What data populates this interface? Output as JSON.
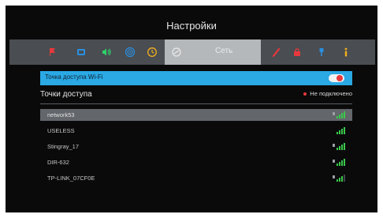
{
  "title": "Настройки",
  "tabs": [
    {
      "icon": "flag-icon",
      "color": "#e8383c"
    },
    {
      "icon": "display-icon",
      "color": "#2a8fe0"
    },
    {
      "icon": "sound-icon",
      "color": "#2fd16b"
    },
    {
      "icon": "broadcast-icon",
      "color": "#2a8fe0"
    },
    {
      "icon": "clock-icon",
      "color": "#f2b01e"
    },
    {
      "icon": "network-icon",
      "label": "Сеть",
      "selected": true
    },
    {
      "icon": "brush-icon",
      "color": "#e8383c"
    },
    {
      "icon": "lock-icon",
      "color": "#e8383c"
    },
    {
      "icon": "usb-icon",
      "color": "#2a8fe0"
    },
    {
      "icon": "info-icon",
      "color": "#f2b01e"
    }
  ],
  "hotspot": {
    "label": "Точка доступа Wi-Fi",
    "enabled": false
  },
  "access_points": {
    "title": "Точки доступа",
    "status": "Не подключено",
    "networks": [
      {
        "name": "network53",
        "secured": true,
        "signal": 4,
        "selected": true
      },
      {
        "name": "USELESS",
        "secured": false,
        "signal": 4
      },
      {
        "name": "Stingray_17",
        "secured": true,
        "signal": 4
      },
      {
        "name": "DIR-632",
        "secured": true,
        "signal": 4
      },
      {
        "name": "TP-LINK_07CF0E",
        "secured": true,
        "signal": 3
      }
    ]
  },
  "colors": {
    "accent": "#2aa9e4",
    "signal": "#3ac84a",
    "alert": "#e8383c"
  }
}
